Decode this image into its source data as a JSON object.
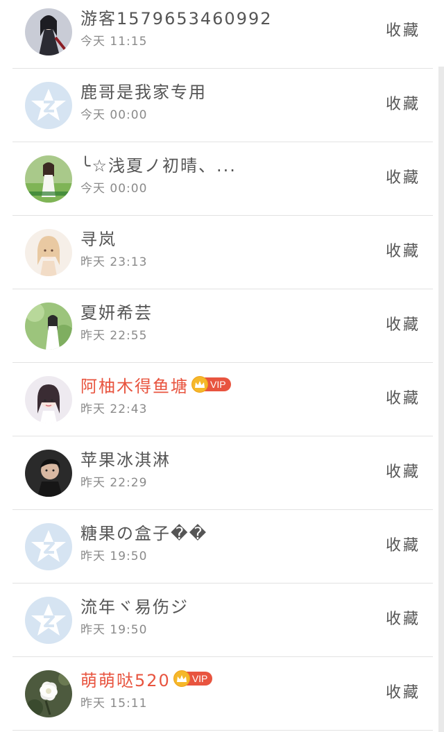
{
  "fav_label": "收藏",
  "rows": [
    {
      "name": "游客1579653460992",
      "time": "今天 11:15",
      "avatar": "avatar-photo-1",
      "vip": false
    },
    {
      "name": "鹿哥是我家专用",
      "time": "今天 00:00",
      "avatar": "default-qq-avatar",
      "vip": false
    },
    {
      "name": "╰☆浅夏ノ初晴、...",
      "time": "今天 00:00",
      "avatar": "avatar-photo-3",
      "vip": false
    },
    {
      "name": "寻岚",
      "time": "昨天 23:13",
      "avatar": "avatar-photo-4",
      "vip": false
    },
    {
      "name": "夏妍希芸",
      "time": "昨天 22:55",
      "avatar": "avatar-photo-5",
      "vip": false
    },
    {
      "name": "阿柚木得鱼塘",
      "time": "昨天 22:43",
      "avatar": "avatar-photo-6",
      "vip": true,
      "vip_label": "VIP"
    },
    {
      "name": "苹果冰淇淋",
      "time": "昨天 22:29",
      "avatar": "avatar-photo-7",
      "vip": false
    },
    {
      "name": "糖果の盒子��",
      "time": "昨天 19:50",
      "avatar": "default-qq-avatar",
      "vip": false
    },
    {
      "name": "流年ヾ易伤ジ",
      "time": "昨天 19:50",
      "avatar": "default-qq-avatar",
      "vip": false
    },
    {
      "name": "萌萌哒520",
      "time": "昨天 15:11",
      "avatar": "avatar-photo-10",
      "vip": true,
      "vip_label": "VIP"
    }
  ],
  "colors": {
    "vip_name": "#e8543f",
    "text": "#555555",
    "time": "#8a8a8a",
    "default_avatar_bg": "#d6e4f2",
    "crown": "#f5b82a"
  }
}
